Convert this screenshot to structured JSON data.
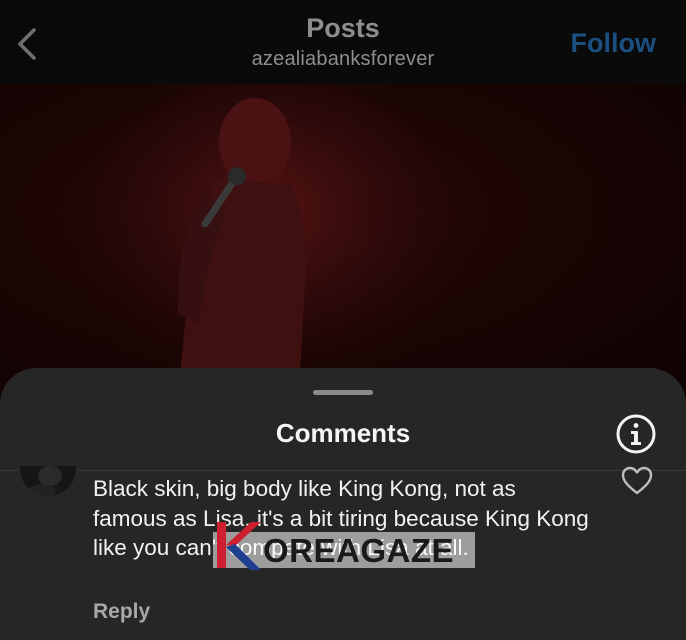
{
  "header": {
    "title": "Posts",
    "username": "azealiabanksforever",
    "follow_label": "Follow",
    "back_icon": "chevron-left-icon"
  },
  "comments_sheet": {
    "title": "Comments",
    "info_icon": "info-icon",
    "comment": {
      "text": "Black skin, big body like King Kong, not as famous as Lisa, it's a bit tiring because King Kong like you can't compete with Lisa at all.",
      "reply_label": "Reply",
      "like_icon": "heart-outline-icon"
    }
  },
  "watermark": {
    "text": "OREAGAZE",
    "logo_letter": "K"
  },
  "colors": {
    "background": "#000000",
    "sheet": "#262626",
    "follow": "#1b4f80",
    "muted_text": "#8e8e8e",
    "photo_tint": "#2d0a0a",
    "watermark_red": "#cc1f2f",
    "watermark_blue": "#1f3f8f"
  }
}
